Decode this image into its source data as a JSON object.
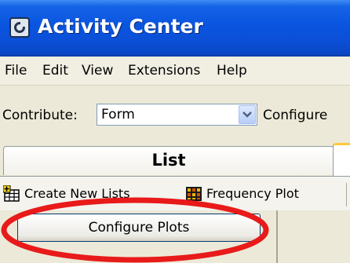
{
  "window": {
    "title": "Activity Center"
  },
  "menubar": {
    "items": [
      "File",
      "Edit",
      "View",
      "Extensions",
      "Help"
    ]
  },
  "contribute": {
    "label": "Contribute:",
    "selected": "Form",
    "configure_label": "Configure"
  },
  "tabs": [
    {
      "label": "List",
      "active": false
    }
  ],
  "toolbar": {
    "create_lists": "Create New Lists",
    "frequency_plot": "Frequency Plot"
  },
  "panel": {
    "configure_plots": "Configure Plots"
  },
  "colors": {
    "title_bar": "#0a55e0",
    "highlight_ellipse": "#e81a1a",
    "active_tab_accent": "#ffc83c"
  }
}
